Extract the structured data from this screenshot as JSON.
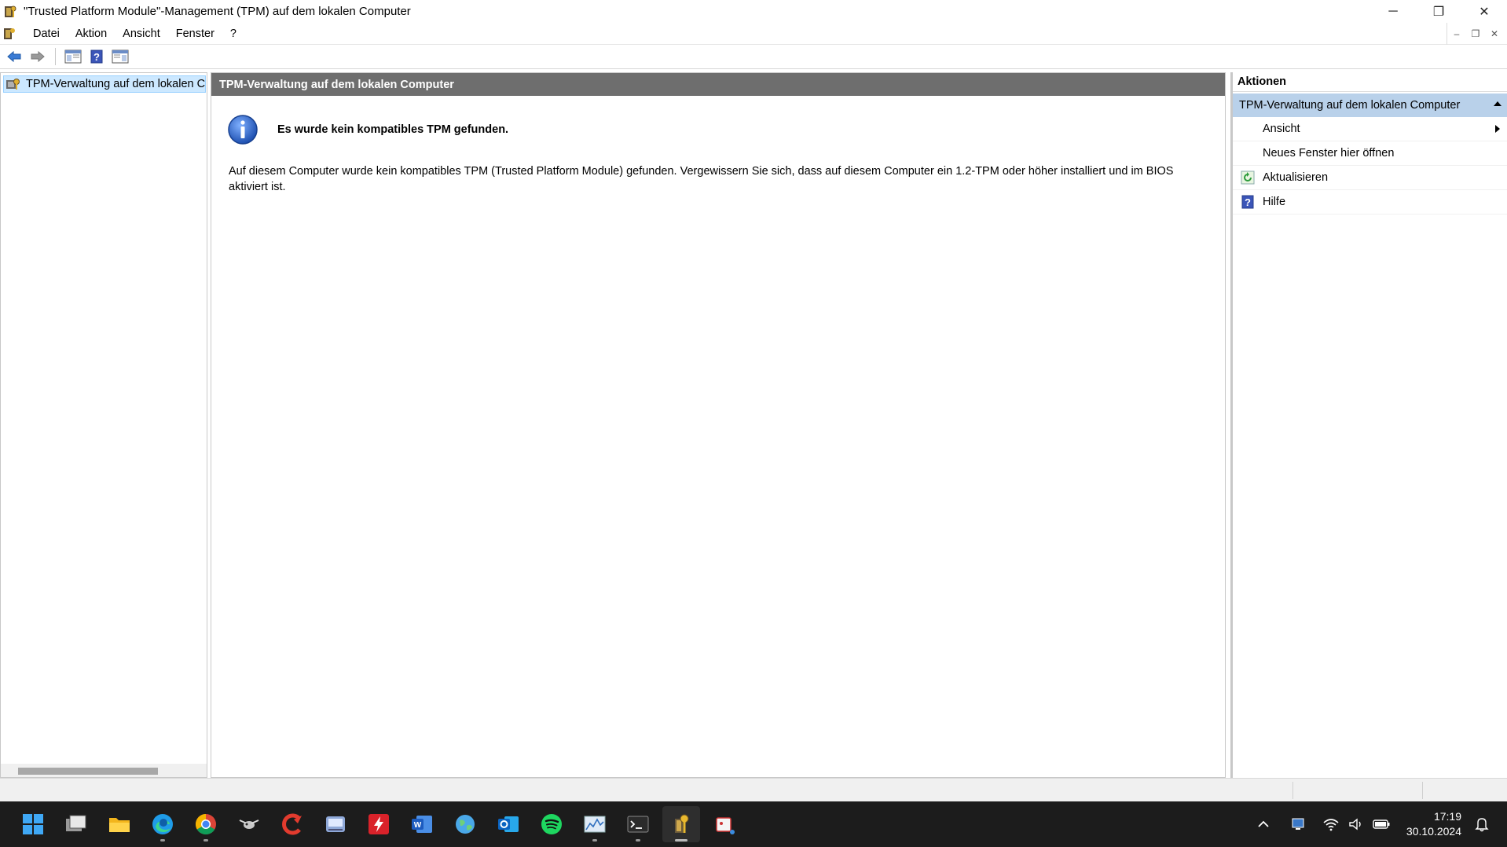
{
  "window": {
    "title": "\"Trusted Platform Module\"-Management (TPM) auf dem lokalen Computer",
    "controls": {
      "minimize": "─",
      "restore": "❐",
      "close": "✕"
    }
  },
  "menubar": {
    "items": [
      "Datei",
      "Aktion",
      "Ansicht",
      "Fenster",
      "?"
    ],
    "mdi": {
      "minimize": "–",
      "restore": "❐",
      "close": "✕"
    }
  },
  "toolbar": {
    "buttons": [
      "back-arrow-icon",
      "forward-arrow-icon",
      "show-hide-console-tree-icon",
      "help-icon",
      "show-hide-action-pane-icon"
    ]
  },
  "tree": {
    "items": [
      {
        "label": "TPM-Verwaltung auf dem lokalen C",
        "selected": true
      }
    ]
  },
  "center": {
    "header": "TPM-Verwaltung auf dem lokalen Computer",
    "info_title": "Es wurde kein kompatibles TPM gefunden.",
    "info_body_line1": "Auf diesem Computer wurde kein kompatibles TPM (Trusted Platform Module) gefunden. Vergewissern Sie sich, dass auf diesem Computer ein 1.2-TPM oder höher installiert und im BIOS",
    "info_body_line2": "aktiviert ist."
  },
  "actions": {
    "header": "Aktionen",
    "section": "TPM-Verwaltung auf dem lokalen Computer",
    "items": [
      {
        "label": "Ansicht",
        "icon": "",
        "submenu": true
      },
      {
        "label": "Neues Fenster hier öffnen",
        "icon": ""
      },
      {
        "label": "Aktualisieren",
        "icon": "refresh-icon"
      },
      {
        "label": "Hilfe",
        "icon": "help-icon"
      }
    ]
  },
  "taskbar": {
    "apps": [
      "windows-start-icon",
      "task-view-icon",
      "file-explorer-icon",
      "edge-icon",
      "chrome-icon",
      "bug-tool-icon",
      "ccleaner-icon",
      "drive-utility-icon",
      "flash-app-icon",
      "word-icon",
      "globe-app-icon",
      "outlook-icon",
      "spotify-icon",
      "resource-monitor-icon",
      "terminal-icon",
      "tpm-console-icon",
      "snipping-tool-icon"
    ],
    "clock_time": "17:19",
    "clock_date": "30.10.2024",
    "tray_icons": [
      "chevron-up-icon",
      "display-icon",
      "wifi-icon",
      "volume-icon",
      "battery-icon",
      "notification-bell-icon"
    ]
  },
  "colors": {
    "center_header_bg": "#6e6e6e",
    "actions_section_bg": "#b9d1ea",
    "tree_selection_bg": "#cce8ff",
    "taskbar_bg": "#1c1c1c"
  }
}
